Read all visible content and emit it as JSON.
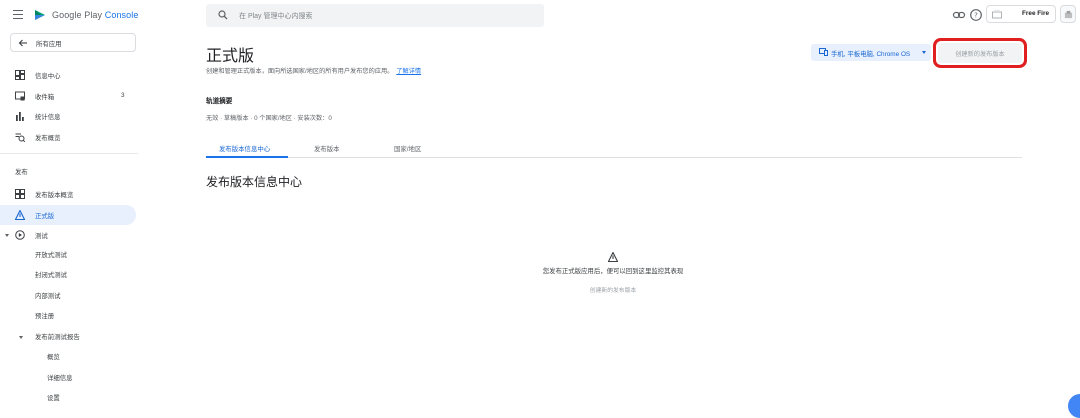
{
  "topbar": {
    "brand_part1": "Google Play",
    "brand_part2": "Console",
    "search_placeholder": "在 Play 管理中心内搜索",
    "account_name": "Free Fire",
    "icons": [
      "menu-icon",
      "play-console-logo",
      "search-icon",
      "link-icon",
      "help-icon",
      "account-icon",
      "avatar-icon"
    ]
  },
  "sidebar": {
    "back_label": "所有应用",
    "items": [
      {
        "label": "信息中心",
        "icon": "dashboard-icon"
      },
      {
        "label": "收件箱",
        "icon": "inbox-icon",
        "count": "3"
      },
      {
        "label": "统计信息",
        "icon": "stats-icon"
      },
      {
        "label": "发布概览",
        "icon": "publish-overview-icon"
      }
    ],
    "release_section_label": "发布",
    "release_items": [
      {
        "label": "发布版本概览",
        "icon": "releases-overview-icon"
      },
      {
        "label": "正式版",
        "icon": "production-icon",
        "active": true
      },
      {
        "label": "测试",
        "icon": "testing-icon"
      }
    ],
    "testing_sub": [
      "开放式测试",
      "封闭式测试",
      "内部测试",
      "预注册"
    ],
    "prelaunch_label": "发布前测试报告",
    "prelaunch_sub": [
      "概览",
      "详细信息",
      "设置"
    ]
  },
  "main": {
    "title": "正式版",
    "description": "创建和管理正式版本，面向所选国家/地区的所有用户发布您的应用。",
    "learn_more": "了解详情",
    "device_filter": "手机, 平板电脑, Chrome OS",
    "create_release_button": "创建新的发布版本",
    "summary_title": "轨道摘要",
    "summary_line": "无效 · 草稿版本 · 0 个国家/地区 · 安装次数：0",
    "tabs": [
      "发布版本信息中心",
      "发布版本",
      "国家/地区"
    ],
    "section_title": "发布版本信息中心",
    "empty_message": "您发布正式版应用后，便可以回到这里监控其表现",
    "empty_link": "创建新的发布版本"
  },
  "colors": {
    "accent": "#1a73e8",
    "active_bg": "#e8f0fe",
    "highlight_box": "#e02020"
  }
}
